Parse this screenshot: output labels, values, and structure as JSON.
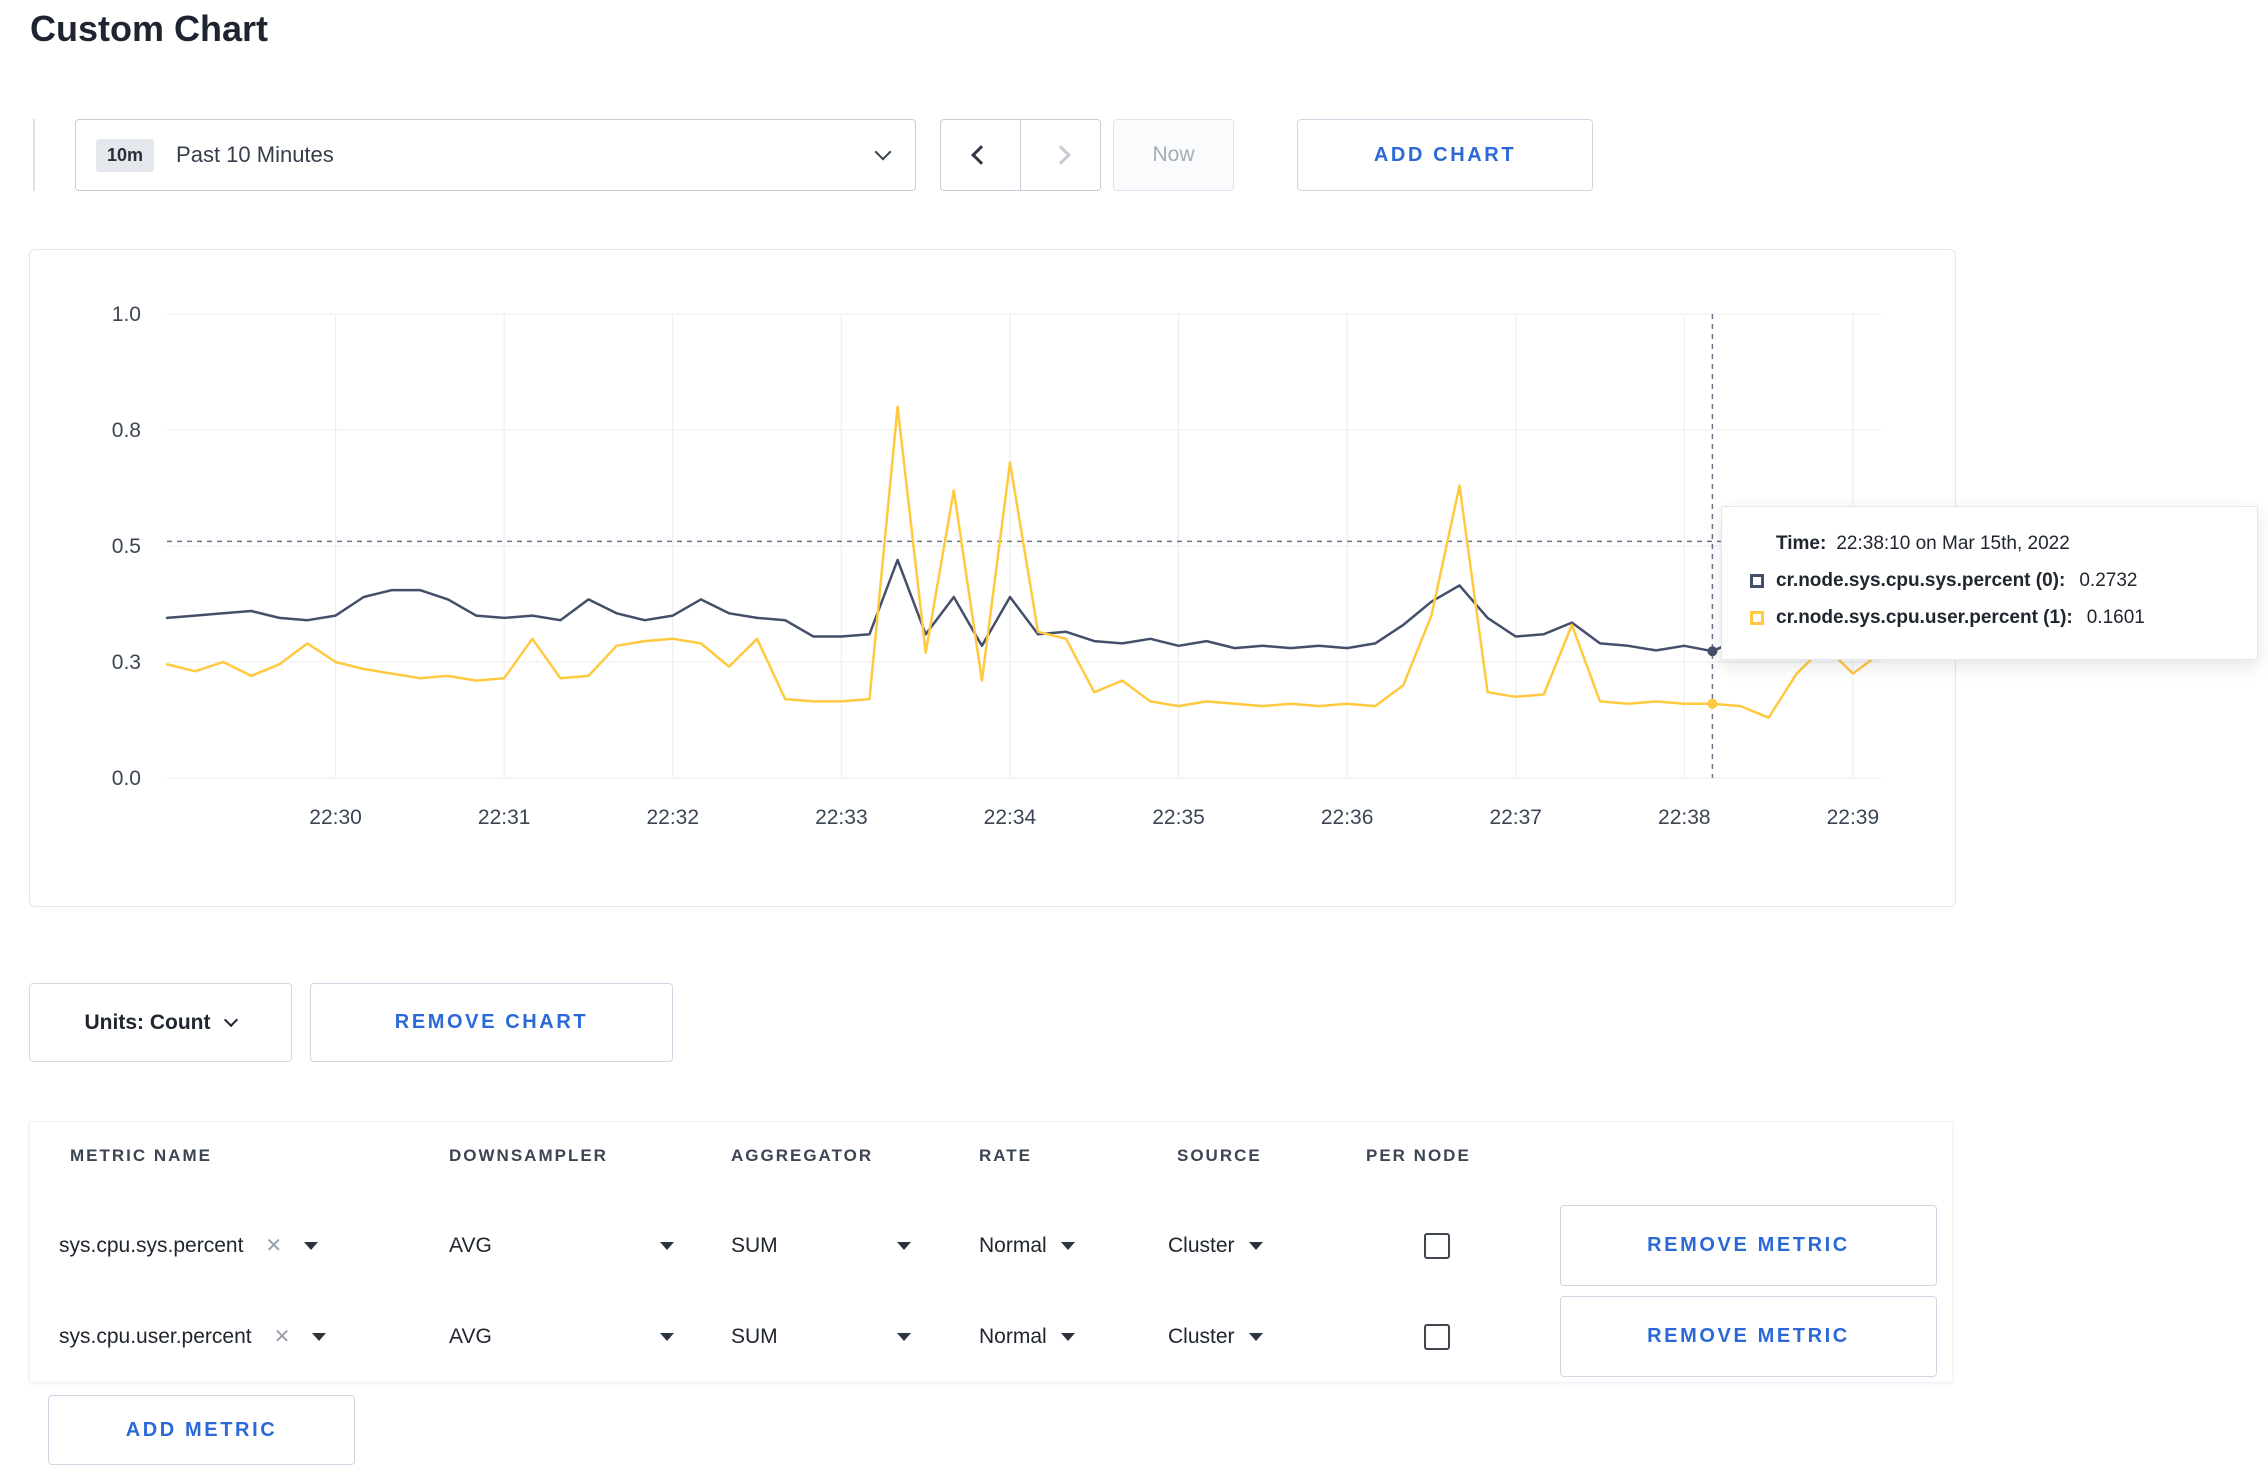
{
  "page": {
    "title": "Custom Chart"
  },
  "colors": {
    "accent_blue": "#2b69d8",
    "series_sys": "#44506a",
    "series_user": "#ffc940",
    "grid": "#ececec",
    "crosshair": "#68748a"
  },
  "icons": {
    "clear_glyph": "✕"
  },
  "toolbar": {
    "range_badge": "10m",
    "range_label": "Past 10 Minutes",
    "now_label": "Now",
    "add_chart_label": "ADD CHART"
  },
  "tooltip": {
    "time_label": "Time:",
    "time_value": "22:38:10 on Mar 15th, 2022",
    "series": [
      {
        "label": "cr.node.sys.cpu.sys.percent (0):",
        "value": "0.2732"
      },
      {
        "label": "cr.node.sys.cpu.user.percent (1):",
        "value": "0.1601"
      }
    ]
  },
  "units": {
    "label": "Units: Count",
    "remove_chart_label": "REMOVE CHART"
  },
  "metrics_table": {
    "headers": [
      "METRIC NAME",
      "DOWNSAMPLER",
      "AGGREGATOR",
      "RATE",
      "SOURCE",
      "PER NODE"
    ],
    "rows": [
      {
        "metric": "sys.cpu.sys.percent",
        "downsampler": "AVG",
        "aggregator": "SUM",
        "rate": "Normal",
        "source": "Cluster",
        "per_node_checked": false,
        "remove_label": "REMOVE METRIC"
      },
      {
        "metric": "sys.cpu.user.percent",
        "downsampler": "AVG",
        "aggregator": "SUM",
        "rate": "Normal",
        "source": "Cluster",
        "per_node_checked": false,
        "remove_label": "REMOVE METRIC"
      }
    ],
    "add_metric_label": "ADD METRIC"
  },
  "chart_data": {
    "type": "line",
    "title": "",
    "xlabel": "",
    "ylabel": "",
    "ylim": [
      0,
      1
    ],
    "grid": true,
    "x_interval_seconds": 10,
    "x_tick_labels": [
      "22:30",
      "22:31",
      "22:32",
      "22:33",
      "22:34",
      "22:35",
      "22:36",
      "22:37",
      "22:38",
      "22:39"
    ],
    "x_tick_indices": [
      6,
      12,
      18,
      24,
      30,
      36,
      42,
      48,
      54,
      60
    ],
    "y_ticks": {
      "labels": [
        "0.0",
        "0.3",
        "0.5",
        "0.8",
        "1.0"
      ],
      "values": [
        0,
        0.25,
        0.5,
        0.75,
        1.0
      ]
    },
    "crosshair": {
      "index": 55,
      "time": "22:38:10 on Mar 15th, 2022",
      "y_value": 0.51
    },
    "series": [
      {
        "name": "cr.node.sys.cpu.sys.percent",
        "color": "#44506a",
        "values": [
          0.345,
          0.35,
          0.355,
          0.36,
          0.345,
          0.34,
          0.35,
          0.39,
          0.405,
          0.405,
          0.385,
          0.35,
          0.345,
          0.35,
          0.34,
          0.385,
          0.355,
          0.34,
          0.35,
          0.385,
          0.355,
          0.345,
          0.34,
          0.305,
          0.305,
          0.31,
          0.47,
          0.31,
          0.39,
          0.285,
          0.39,
          0.31,
          0.315,
          0.295,
          0.29,
          0.3,
          0.285,
          0.295,
          0.28,
          0.285,
          0.28,
          0.285,
          0.28,
          0.29,
          0.33,
          0.38,
          0.415,
          0.345,
          0.305,
          0.31,
          0.335,
          0.29,
          0.285,
          0.275,
          0.285,
          0.2732,
          0.3,
          0.31,
          0.295,
          0.3,
          0.295,
          0.3
        ]
      },
      {
        "name": "cr.node.sys.cpu.user.percent",
        "color": "#ffc940",
        "values": [
          0.245,
          0.23,
          0.25,
          0.22,
          0.245,
          0.29,
          0.25,
          0.235,
          0.225,
          0.215,
          0.22,
          0.21,
          0.215,
          0.3,
          0.215,
          0.22,
          0.285,
          0.295,
          0.3,
          0.29,
          0.24,
          0.3,
          0.17,
          0.165,
          0.165,
          0.17,
          0.8,
          0.27,
          0.62,
          0.21,
          0.68,
          0.315,
          0.3,
          0.185,
          0.21,
          0.165,
          0.155,
          0.165,
          0.16,
          0.155,
          0.16,
          0.155,
          0.16,
          0.155,
          0.2,
          0.35,
          0.63,
          0.185,
          0.175,
          0.18,
          0.33,
          0.165,
          0.16,
          0.165,
          0.16,
          0.1601,
          0.155,
          0.13,
          0.225,
          0.285,
          0.225,
          0.27
        ]
      }
    ]
  }
}
